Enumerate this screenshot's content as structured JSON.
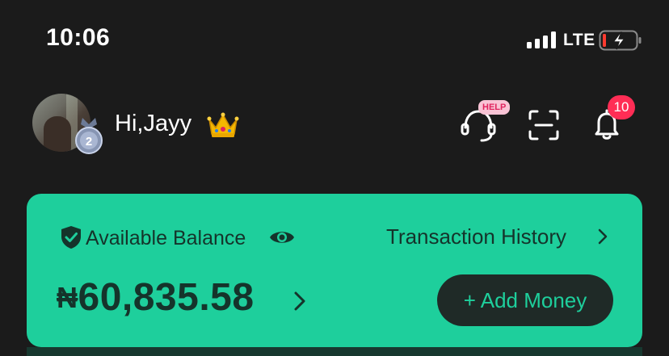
{
  "status_bar": {
    "time": "10:06",
    "network": "LTE"
  },
  "header": {
    "greeting": "Hi,Jayy",
    "avatar_level": "2",
    "help_badge": "HELP",
    "notification_count": "10"
  },
  "balance_card": {
    "label": "Available Balance",
    "history_link": "Transaction History",
    "currency": "₦",
    "amount": "60,835.58",
    "add_money_label": "+ Add Money"
  },
  "colors": {
    "background": "#1b1b1b",
    "card_accent": "#1ecf9c",
    "notification_badge": "#ff2d55",
    "button_dark": "#1f2a27"
  }
}
